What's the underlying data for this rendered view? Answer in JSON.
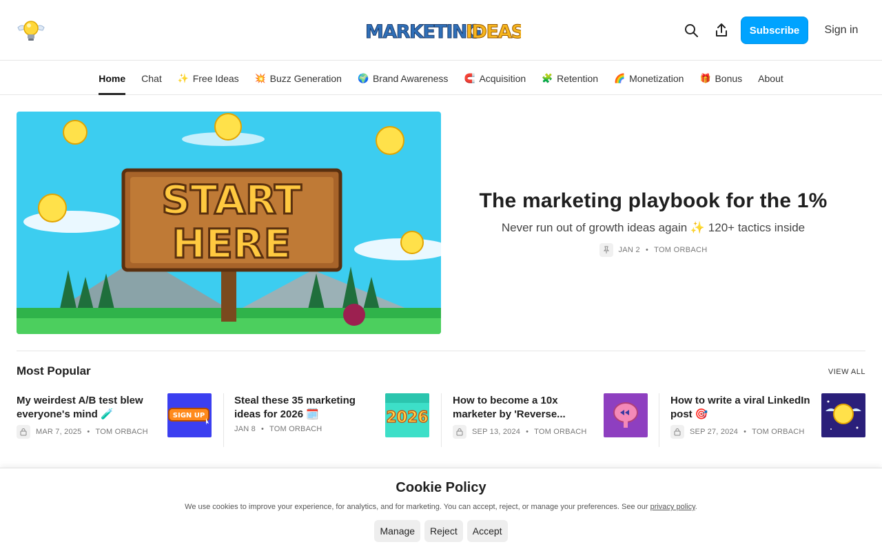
{
  "header": {
    "logo_wordmark": "MARKETINGIDEAS",
    "subscribe_label": "Subscribe",
    "signin_label": "Sign in",
    "accent_color": "#00a3ff"
  },
  "nav": {
    "items": [
      {
        "label": "Home",
        "icon": ""
      },
      {
        "label": "Chat",
        "icon": ""
      },
      {
        "label": "Free Ideas",
        "icon": "✨"
      },
      {
        "label": "Buzz Generation",
        "icon": "💥"
      },
      {
        "label": "Brand Awareness",
        "icon": "🌍"
      },
      {
        "label": "Acquisition",
        "icon": "🧲"
      },
      {
        "label": "Retention",
        "icon": "🧩"
      },
      {
        "label": "Monetization",
        "icon": "🌈"
      },
      {
        "label": "Bonus",
        "icon": "🎁"
      },
      {
        "label": "About",
        "icon": ""
      }
    ]
  },
  "hero": {
    "image_text_line1": "START",
    "image_text_line2": "HERE",
    "title": "The marketing playbook for the 1%",
    "subtitle": "Never run out of growth ideas again ✨ 120+ tactics inside",
    "date": "JAN 2",
    "author": "TOM ORBACH"
  },
  "most_popular": {
    "title": "Most Popular",
    "view_all": "VIEW ALL",
    "posts": [
      {
        "title": "My weirdest A/B test blew everyone's mind 🧪",
        "date": "MAR 7, 2025",
        "author": "TOM ORBACH",
        "locked": true,
        "thumb_text": "SIGN UP"
      },
      {
        "title": "Steal these 35 marketing ideas for 2026 🗓️",
        "date": "JAN 8",
        "author": "TOM ORBACH",
        "locked": false,
        "thumb_text": "2026"
      },
      {
        "title": "How to become a 10x marketer by 'Reverse...",
        "date": "SEP 13, 2024",
        "author": "TOM ORBACH",
        "locked": true,
        "thumb_text": ""
      },
      {
        "title": "How to write a viral LinkedIn post 🎯",
        "date": "SEP 27, 2024",
        "author": "TOM ORBACH",
        "locked": true,
        "thumb_text": ""
      }
    ]
  },
  "cookie": {
    "title": "Cookie Policy",
    "text": "We use cookies to improve your experience, for analytics, and for marketing. You can accept, reject, or manage your preferences. See our ",
    "link": "privacy policy",
    "text_end": ".",
    "manage": "Manage",
    "reject": "Reject",
    "accept": "Accept"
  }
}
